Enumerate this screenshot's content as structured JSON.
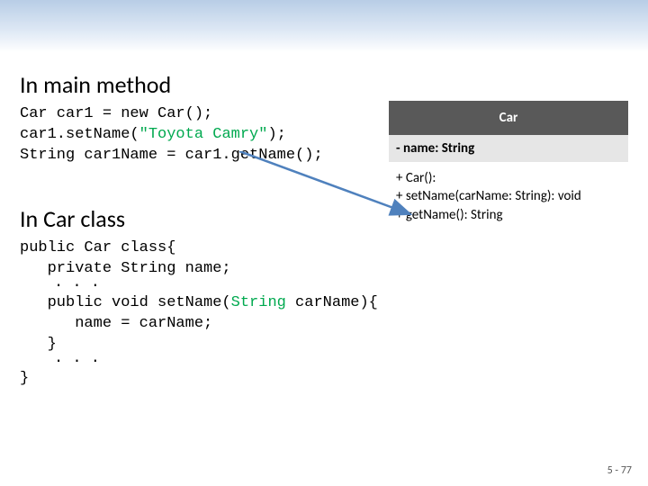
{
  "headings": {
    "main_method": "In main method",
    "car_class": "In Car class"
  },
  "code": {
    "main_line1": "Car car1 = new Car();",
    "main_line2a": "car1.setName(",
    "main_line2b": "\"Toyota Camry\"",
    "main_line2c": ");",
    "main_line3": "String car1Name = car1.getName();",
    "cls_line1": "public Car class{",
    "cls_line2": "   private String name;",
    "cls_ellipsis1": ". . .",
    "cls_setA": "   public void setName(",
    "cls_setB": "String",
    "cls_setC": " carName){",
    "cls_setBody": "      name = carName;",
    "cls_setEnd": "   }",
    "cls_ellipsis2": ". . .",
    "cls_end": "}"
  },
  "uml": {
    "title": "Car",
    "attrs": "- name: String",
    "op1": "+ Car():",
    "op2": "+ setName(carName: String): void",
    "op3": "+ getName(): String"
  },
  "footer": "5 - 77"
}
